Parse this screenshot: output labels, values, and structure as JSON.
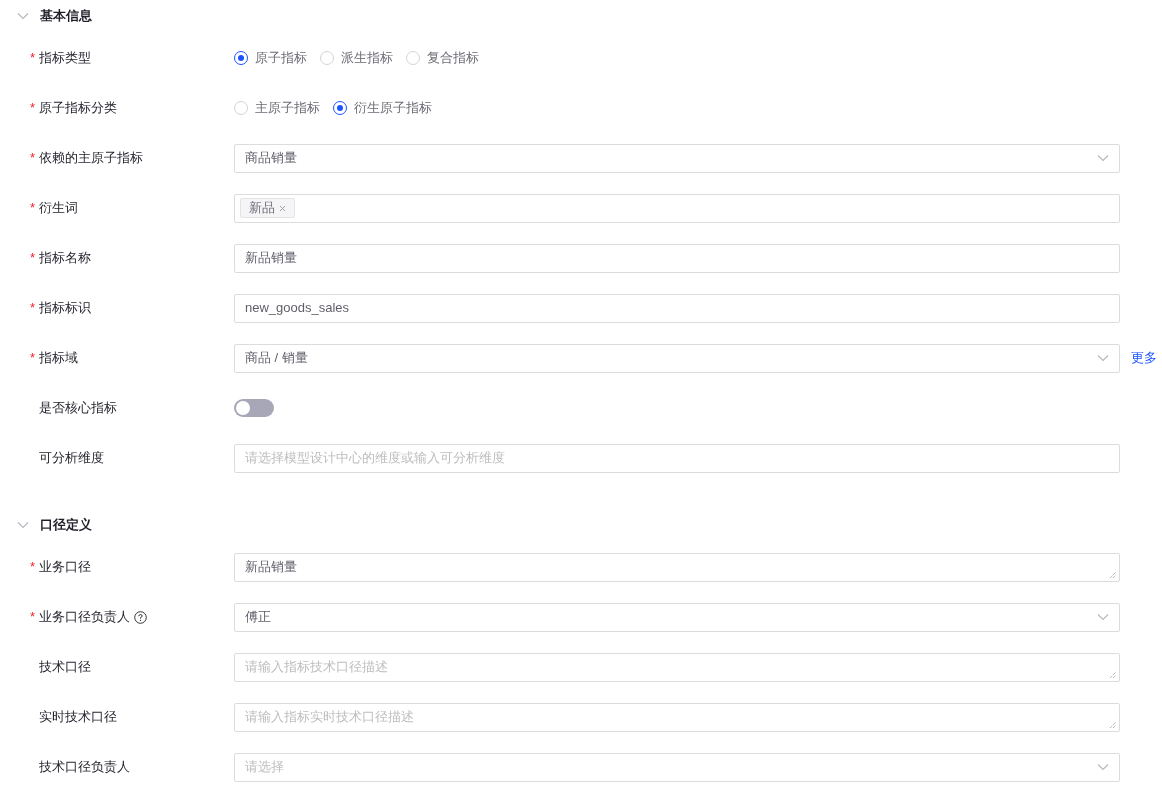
{
  "sections": [
    {
      "title": "基本信息",
      "expanded": true,
      "fields": [
        {
          "kind": "radio",
          "label": "指标类型",
          "marker": "*",
          "options": [
            {
              "label": "原子指标",
              "selected": true
            },
            {
              "label": "派生指标",
              "selected": false
            },
            {
              "label": "复合指标",
              "selected": false
            }
          ]
        },
        {
          "kind": "radio",
          "label": "原子指标分类",
          "marker": "*",
          "options": [
            {
              "label": "主原子指标",
              "selected": false
            },
            {
              "label": "衍生原子指标",
              "selected": true
            }
          ]
        },
        {
          "kind": "select",
          "label": "依赖的主原子指标",
          "marker": "*",
          "value": "商品销量"
        },
        {
          "kind": "tags",
          "label": "衍生词",
          "marker": "*",
          "tags": [
            "新品"
          ]
        },
        {
          "kind": "input",
          "label": "指标名称",
          "marker": "*",
          "value": "新品销量"
        },
        {
          "kind": "input",
          "label": "指标标识",
          "marker": "*",
          "value": "new_goods_sales"
        },
        {
          "kind": "select",
          "label": "指标域",
          "marker": "*",
          "value": "商品 / 销量",
          "link": "更多"
        },
        {
          "kind": "switch",
          "label": "是否核心指标",
          "on": false
        },
        {
          "kind": "input",
          "label": "可分析维度",
          "placeholder": "请选择模型设计中心的维度或输入可分析维度"
        }
      ]
    },
    {
      "title": "口径定义",
      "expanded": true,
      "fields": [
        {
          "kind": "textarea",
          "label": "业务口径",
          "marker": "*",
          "value": "新品销量"
        },
        {
          "kind": "select",
          "label": "业务口径负责人",
          "marker": "*",
          "help": true,
          "value": "傅正"
        },
        {
          "kind": "textarea",
          "label": "技术口径",
          "placeholder": "请输入指标技术口径描述"
        },
        {
          "kind": "textarea",
          "label": "实时技术口径",
          "placeholder": "请输入指标实时技术口径描述"
        },
        {
          "kind": "select",
          "label": "技术口径负责人",
          "placeholder": "请选择"
        }
      ]
    }
  ]
}
